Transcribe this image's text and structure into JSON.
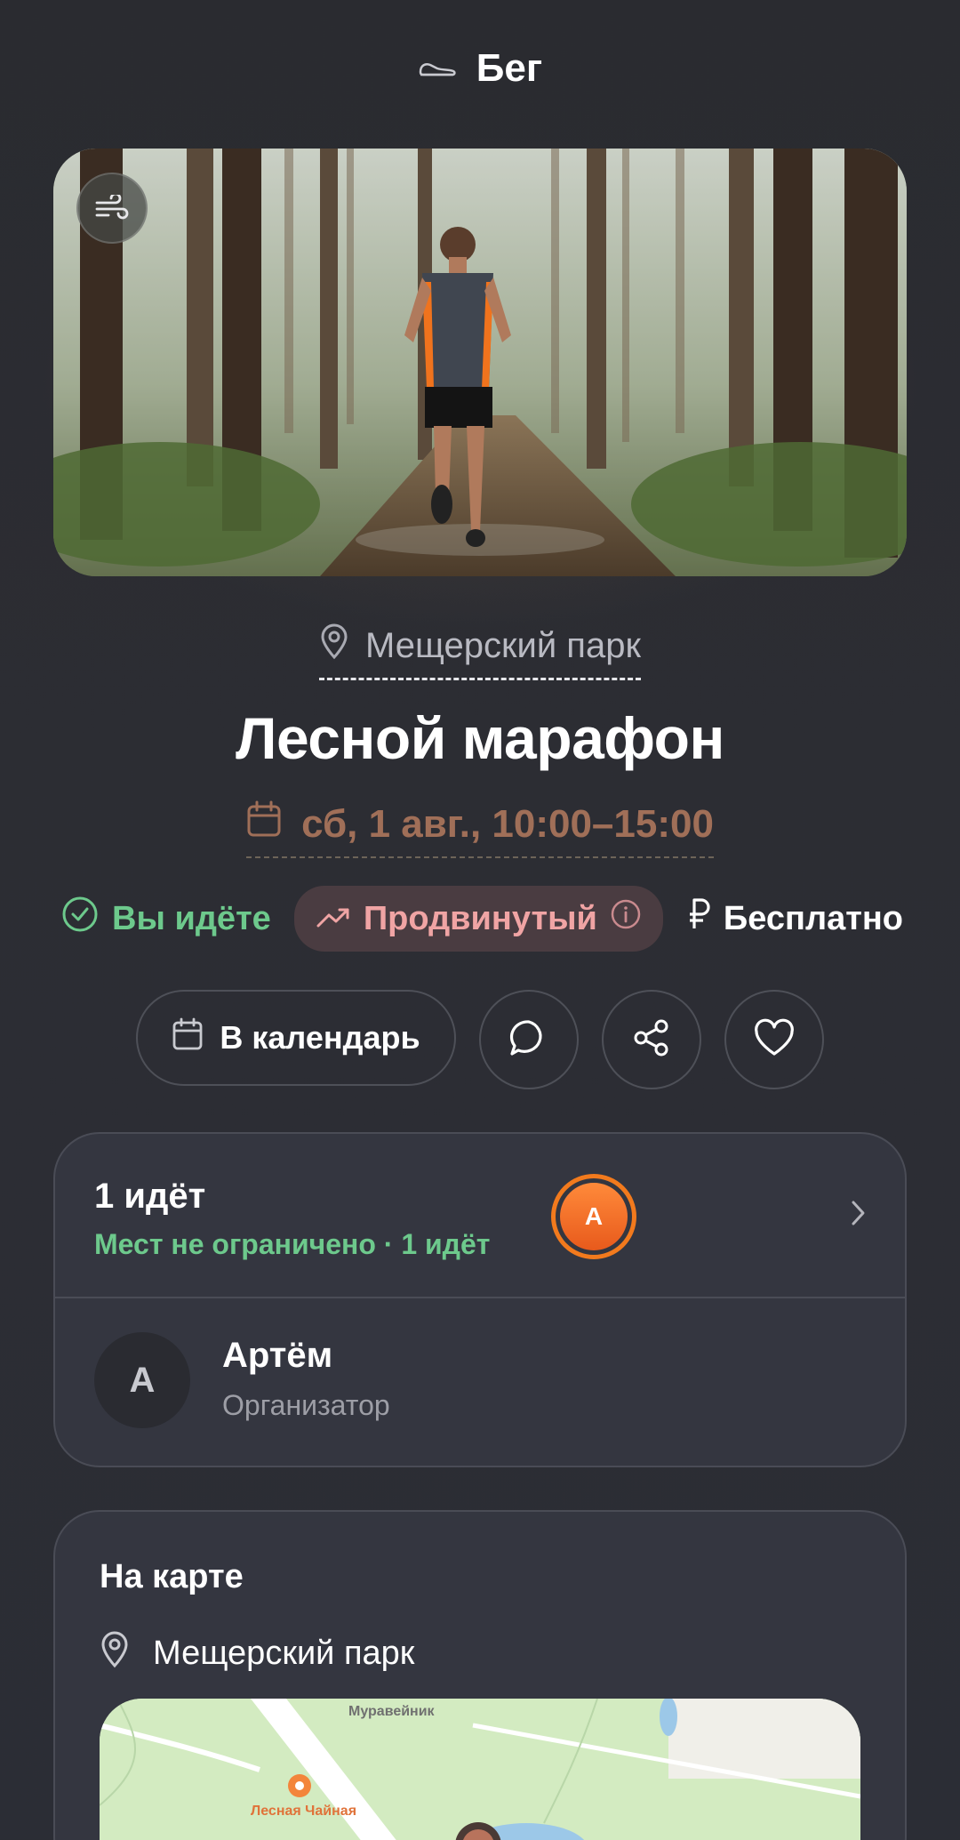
{
  "header": {
    "title": "Бег",
    "icon": "sneaker-icon"
  },
  "hero": {
    "badge_icon": "wind-icon"
  },
  "event": {
    "location": "Мещерский парк",
    "title": "Лесной марафон",
    "date": "сб, 1 авг., 10:00–15:00"
  },
  "chips": {
    "going": "Вы идёте",
    "level": "Продвинутый",
    "price": "Бесплатно"
  },
  "actions": {
    "calendar": "В календарь"
  },
  "participants": {
    "count": "1 идёт",
    "subtitle": "Мест не ограничено · 1 идёт",
    "avatar_letter": "А"
  },
  "organizer": {
    "letter": "А",
    "name": "Артём",
    "role": "Организатор"
  },
  "map": {
    "title": "На карте",
    "place": "Мещерский парк",
    "labels": {
      "anthill": "Муравейник",
      "tea": "Лесная Чайная"
    }
  },
  "colors": {
    "going": "#6dc98c",
    "date": "#a06f58",
    "level_bg": "#4a3c41",
    "level_text": "#f0a4a4",
    "avatar_ring": "#f27a1d"
  }
}
